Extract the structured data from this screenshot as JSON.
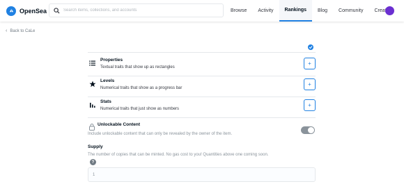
{
  "header": {
    "logo_text": "OpenSea",
    "search_placeholder": "Search items, collections, and accounts",
    "nav": [
      "Browse",
      "Activity",
      "Rankings",
      "Blog",
      "Community",
      "Create"
    ],
    "active_nav": "Rankings"
  },
  "back_link": "Back to CaLe",
  "properties": {
    "title": "Properties",
    "subtitle": "Textual traits that show up as rectangles"
  },
  "levels": {
    "title": "Levels",
    "subtitle": "Numerical traits that show as a progress bar"
  },
  "stats": {
    "title": "Stats",
    "subtitle": "Numerical traits that just show as numbers"
  },
  "plus_label": "+",
  "unlockable": {
    "title": "Unlockable Content",
    "subtitle": "Include unlockable content that can only be revealed by the owner of the item."
  },
  "supply": {
    "title": "Supply",
    "subtitle": "The number of copies that can be minted. No gas cost to you! Quantities above one coming soon.",
    "help_symbol": "?",
    "value": "1"
  },
  "colors": {
    "accent": "#2081e2",
    "avatar": "#6b2fd1",
    "toggle_off": "#8a939b"
  }
}
